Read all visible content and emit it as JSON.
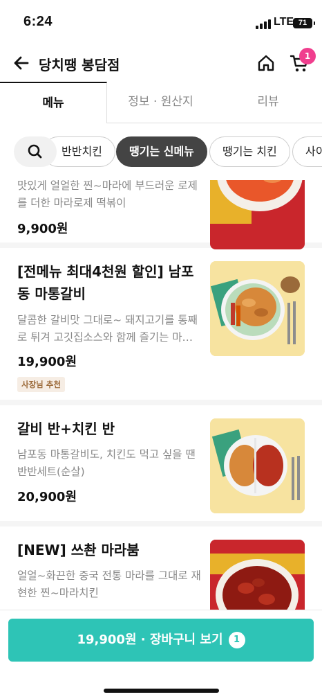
{
  "status_bar": {
    "time": "6:24",
    "network": "LTE",
    "battery": "71"
  },
  "header": {
    "store_name": "당치땡 봉담점",
    "cart_count": "1"
  },
  "tabs": [
    {
      "label": "메뉴",
      "active": true
    },
    {
      "label": "정보 · 원산지",
      "active": false
    },
    {
      "label": "리뷰",
      "active": false
    }
  ],
  "categories": [
    {
      "label": "반반치킨",
      "active": false
    },
    {
      "label": "땡기는 신메뉴",
      "active": true
    },
    {
      "label": "땡기는 치킨",
      "active": false
    },
    {
      "label": "사이",
      "active": false
    }
  ],
  "menu_items": [
    {
      "name": "",
      "desc": "맛있게 얼얼한 찐~마라에 부드러운 로제를 더한 마라로제 떡볶이",
      "price": "9,900원",
      "badge": ""
    },
    {
      "name": "[전메뉴 최대4천원 할인] 남포동 마통갈비",
      "desc": "달콤한 갈비맛 그대로~ 돼지고기를 통째로 튀겨 고깃집소스와 함께 즐기는 마…",
      "price": "19,900원",
      "badge": "사장님 추천"
    },
    {
      "name": "갈비 반+치킨 반",
      "desc": "남포동 마통갈비도, 치킨도 먹고 싶을 땐 반반세트(순살)",
      "price": "20,900원",
      "badge": ""
    },
    {
      "name": "[NEW] 쓰촨 마라붐",
      "desc": "얼얼~화끈한 중국 전통 마라를 그대로 재현한 찐~마라치킨",
      "price": "",
      "badge": ""
    }
  ],
  "cart_bar": {
    "label": "19,900원 · 장바구니 보기",
    "count": "1"
  },
  "colors": {
    "accent": "#2ec4b6",
    "badge": "#f03e8e",
    "active_chip": "#444444"
  }
}
